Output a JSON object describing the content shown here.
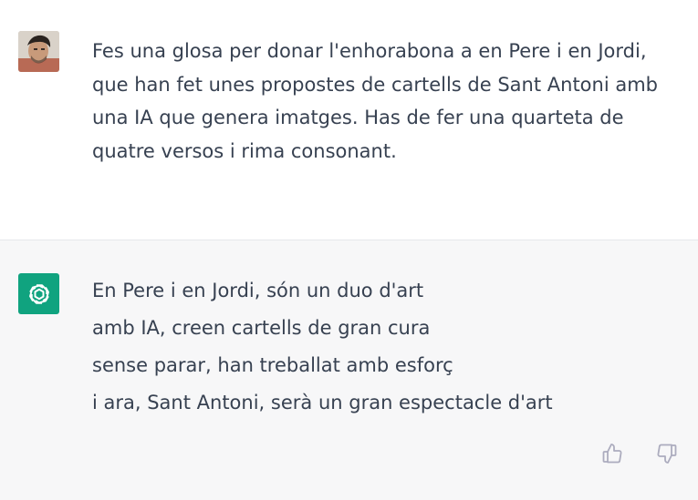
{
  "conversation": {
    "user_message": {
      "avatar_icon": "user-avatar-photo",
      "text": "Fes una glosa per donar l'enhorabona a en Pere i en Jordi,\nque han fet unes propostes de cartells de Sant Antoni amb\nuna IA que genera imatges. Has de fer una quarteta de\nquatre versos i rima consonant."
    },
    "assistant_message": {
      "avatar_icon": "openai-logo-icon",
      "avatar_color": "#10a37f",
      "lines": [
        "En Pere i en Jordi, són un duo d'art",
        "amb IA, creen cartells de gran cura",
        "sense parar, han treballat amb esforç",
        "i ara, Sant Antoni, serà un gran espectacle d'art"
      ]
    },
    "feedback": {
      "thumbs_up_icon": "thumbs-up-icon",
      "thumbs_down_icon": "thumbs-down-icon"
    }
  },
  "colors": {
    "text": "#374151",
    "assistant_background": "#f7f7f8",
    "icon_gray": "#acacbe"
  }
}
